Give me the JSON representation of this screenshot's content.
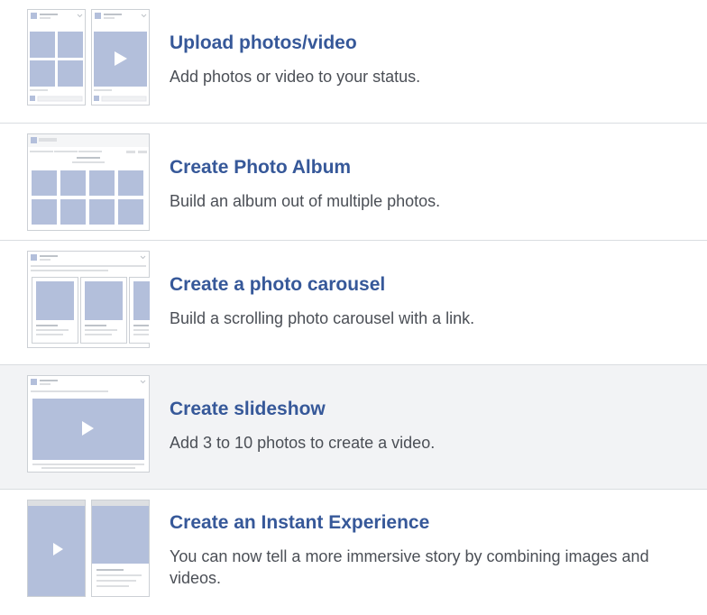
{
  "menu": {
    "items": [
      {
        "title": "Upload photos/video",
        "description": "Add photos or video to your status.",
        "icon": "upload-photos-video-icon"
      },
      {
        "title": "Create Photo Album",
        "description": "Build an album out of multiple photos.",
        "icon": "photo-album-icon"
      },
      {
        "title": "Create a photo carousel",
        "description": "Build a scrolling photo carousel with a link.",
        "icon": "photo-carousel-icon"
      },
      {
        "title": "Create slideshow",
        "description": "Add 3 to 10 photos to create a video.",
        "icon": "slideshow-icon"
      },
      {
        "title": "Create an Instant Experience",
        "description": "You can now tell a more immersive story by combining images and videos.",
        "icon": "instant-experience-icon"
      }
    ],
    "hovered_index": 3
  },
  "colors": {
    "title": "#365899",
    "description": "#4b4f56",
    "divider": "#dadde1",
    "hover_background": "#f2f3f5",
    "placeholder_fill": "#b3bfdb"
  }
}
